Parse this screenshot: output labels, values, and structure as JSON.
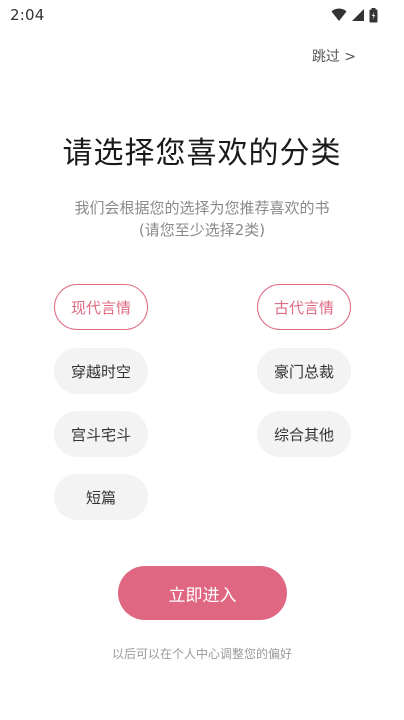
{
  "status_bar": {
    "time": "2:04",
    "icons": [
      "wifi-icon",
      "signal-icon",
      "battery-icon"
    ]
  },
  "skip_label": "跳过 >",
  "title": "请选择您喜欢的分类",
  "subtitle": {
    "line1": "我们会根据您的选择为您推荐喜欢的书",
    "line2": "(请您至少选择2类)"
  },
  "categories": [
    {
      "label": "现代言情",
      "selected": true
    },
    {
      "label": "古代言情",
      "selected": true
    },
    {
      "label": "穿越时空",
      "selected": false
    },
    {
      "label": "豪门总裁",
      "selected": false
    },
    {
      "label": "宫斗宅斗",
      "selected": false
    },
    {
      "label": "综合其他",
      "selected": false
    },
    {
      "label": "短篇",
      "selected": false
    }
  ],
  "enter_button_label": "立即进入",
  "footer_note": "以后可以在个人中心调整您的偏好",
  "colors": {
    "accent": "#e06782",
    "selected_border": "#df6b82",
    "chip_background": "#f3f3f3"
  }
}
